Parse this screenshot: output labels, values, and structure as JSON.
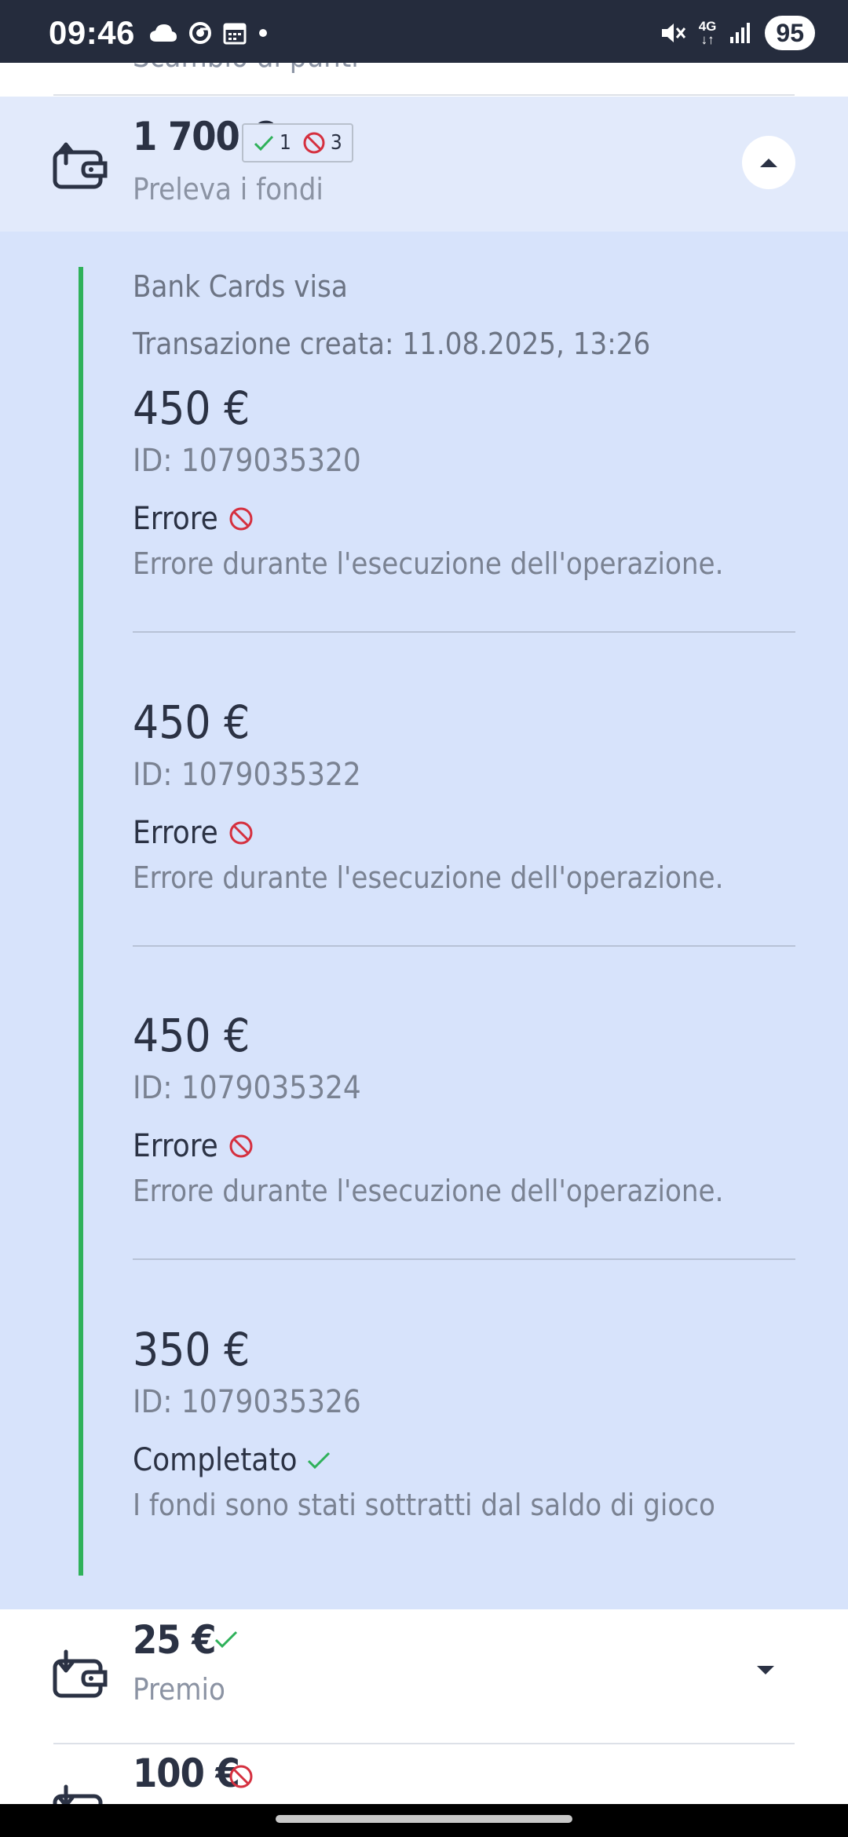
{
  "status_bar": {
    "time": "09:46",
    "network": "4G",
    "battery": "95",
    "icons_left": [
      "cloud-icon",
      "chrome-icon",
      "calendar-icon",
      "dot-icon"
    ],
    "icons_right": [
      "mute-icon",
      "network-4g-icon",
      "signal-icon",
      "battery-icon"
    ]
  },
  "previous_row": {
    "label": "Scambio di punti"
  },
  "group": {
    "amount": "1 700 €",
    "success_count": "1",
    "error_count": "3",
    "subtitle": "Preleva i fondi",
    "method": "Bank Cards visa",
    "created": "Transazione creata: 11.08.2025, 13:26",
    "transactions": [
      {
        "amount": "450 €",
        "id": "ID: 1079035320",
        "status": "Errore",
        "status_type": "error",
        "message": "Errore durante l'esecuzione dell'operazione."
      },
      {
        "amount": "450 €",
        "id": "ID: 1079035322",
        "status": "Errore",
        "status_type": "error",
        "message": "Errore durante l'esecuzione dell'operazione."
      },
      {
        "amount": "450 €",
        "id": "ID: 1079035324",
        "status": "Errore",
        "status_type": "error",
        "message": "Errore durante l'esecuzione dell'operazione."
      },
      {
        "amount": "350 €",
        "id": "ID: 1079035326",
        "status": "Completato",
        "status_type": "success",
        "message": "I fondi sono stati sottratti dal saldo di gioco"
      }
    ]
  },
  "rows": [
    {
      "amount": "25 €",
      "subtitle": "Premio",
      "status_type": "success"
    },
    {
      "amount": "100 €",
      "subtitle": "",
      "status_type": "error"
    }
  ],
  "colors": {
    "status_bar": "#252c3d",
    "expanded_bg": "#d7e3fb",
    "header_bg": "#e2eafb",
    "success": "#2fb15a",
    "error": "#d5303f",
    "text_dark": "#2b3244",
    "text_muted": "#7a8292"
  }
}
